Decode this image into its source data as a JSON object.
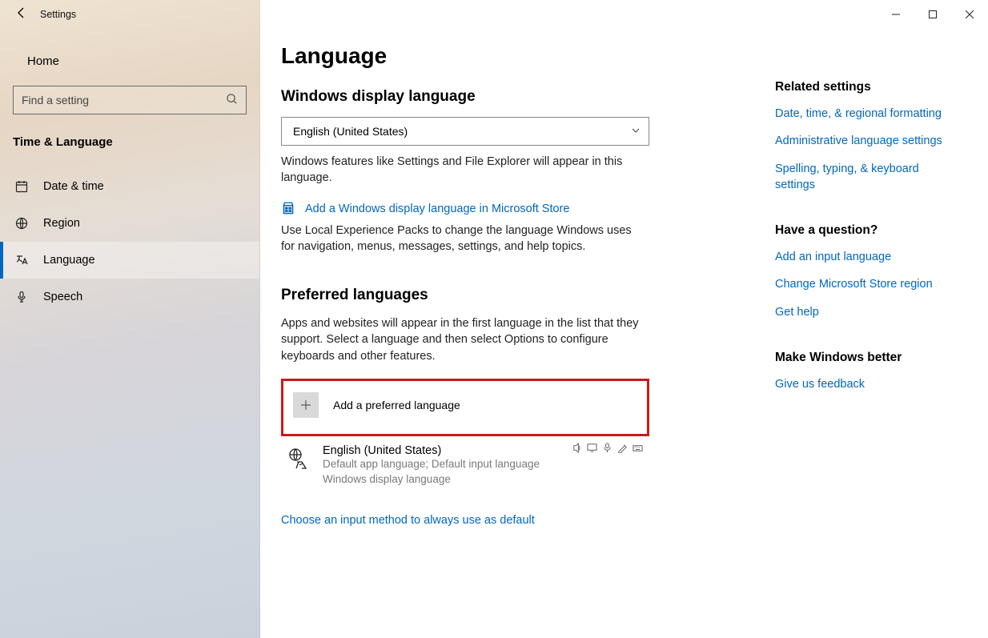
{
  "window": {
    "title": "Settings"
  },
  "sidebar": {
    "home": "Home",
    "search_placeholder": "Find a setting",
    "section": "Time & Language",
    "items": [
      {
        "label": "Date & time"
      },
      {
        "label": "Region"
      },
      {
        "label": "Language"
      },
      {
        "label": "Speech"
      }
    ]
  },
  "page": {
    "title": "Language",
    "display": {
      "heading": "Windows display language",
      "selected": "English (United States)",
      "description": "Windows features like Settings and File Explorer will appear in this language.",
      "store_link": "Add a Windows display language in Microsoft Store",
      "store_desc": "Use Local Experience Packs to change the language Windows uses for navigation, menus, messages, settings, and help topics."
    },
    "preferred": {
      "heading": "Preferred languages",
      "description": "Apps and websites will appear in the first language in the list that they support. Select a language and then select Options to configure keyboards and other features.",
      "add_label": "Add a preferred language",
      "item": {
        "name": "English (United States)",
        "subtitle1": "Default app language; Default input language",
        "subtitle2": "Windows display language"
      },
      "choose_default_link": "Choose an input method to always use as default"
    }
  },
  "right": {
    "related": {
      "heading": "Related settings",
      "links": [
        "Date, time, & regional formatting",
        "Administrative language settings",
        "Spelling, typing, & keyboard settings"
      ]
    },
    "question": {
      "heading": "Have a question?",
      "links": [
        "Add an input language",
        "Change Microsoft Store region",
        "Get help"
      ]
    },
    "better": {
      "heading": "Make Windows better",
      "links": [
        "Give us feedback"
      ]
    }
  }
}
